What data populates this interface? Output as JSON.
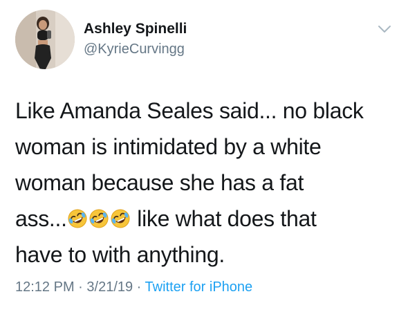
{
  "user": {
    "display_name": "Ashley Spinelli",
    "handle": "@KyrieCurvingg"
  },
  "tweet": {
    "line1": "Like Amanda Seales said... no black",
    "line2": "woman is intimidated by a white",
    "line3": "woman because she has a fat",
    "line4_start": "ass...",
    "line4_emojis": [
      "rolling-on-floor-laughing-emoji",
      "rolling-on-floor-laughing-emoji",
      "rolling-on-floor-laughing-emoji"
    ],
    "line4_end": " like what does that",
    "line5": "have to with anything."
  },
  "meta": {
    "time": "12:12 PM",
    "separator": " · ",
    "date": "3/21/19",
    "source": "Twitter for iPhone"
  },
  "icons": {
    "menu": "chevron-down-icon"
  },
  "colors": {
    "text": "#14171a",
    "secondary": "#657786",
    "link": "#1da1f2",
    "emoji_face": "#f7c53a"
  }
}
